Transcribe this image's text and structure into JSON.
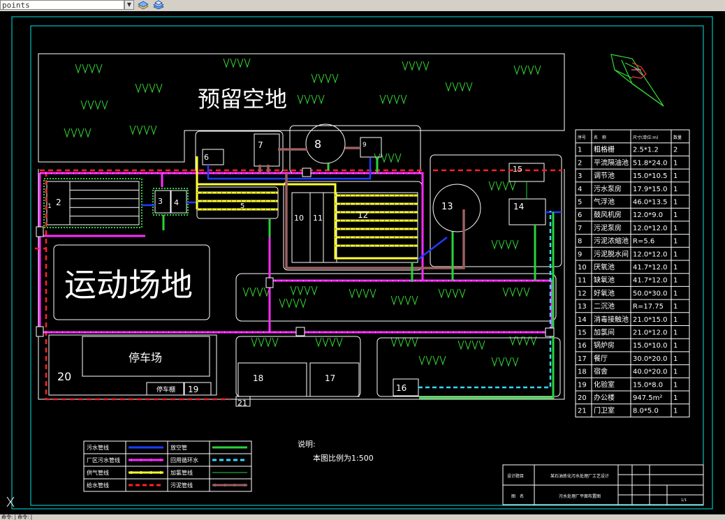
{
  "toolbar": {
    "input_value": "points",
    "drop_icon": "chevron-down-icon",
    "layer_icons": [
      "layers-icon",
      "layers-stack-icon"
    ]
  },
  "status": {
    "text": "命令: | 命令: |"
  },
  "labels": {
    "reserved_land": "预留空地",
    "sports_field": "运动场地",
    "parking": "停车场",
    "parking_shed": "停车棚",
    "building_numbers": [
      "1",
      "2",
      "3",
      "4",
      "5",
      "6",
      "7",
      "8",
      "9",
      "10",
      "11",
      "12",
      "13",
      "14",
      "15",
      "16",
      "17",
      "18",
      "19",
      "20",
      "21"
    ]
  },
  "table": {
    "headers": [
      "序号",
      "名　称",
      "尺寸(单位:m)",
      "数量"
    ],
    "rows": [
      [
        "1",
        "粗格栅",
        "2.5*1.2",
        "2"
      ],
      [
        "2",
        "平流隔油池",
        "51.8*24.0",
        "1"
      ],
      [
        "3",
        "调节池",
        "15.0*10.5",
        "1"
      ],
      [
        "4",
        "污水泵房",
        "17.9*15.0",
        "1"
      ],
      [
        "5",
        "气浮池",
        "46.0*13.5",
        "1"
      ],
      [
        "6",
        "鼓风机房",
        "12.0*9.0",
        "1"
      ],
      [
        "7",
        "污泥泵房",
        "12.0*12.0",
        "1"
      ],
      [
        "8",
        "污泥浓缩池",
        "R=5.6",
        "1"
      ],
      [
        "9",
        "污泥脱水间",
        "12.0*12.0",
        "1"
      ],
      [
        "10",
        "厌氧池",
        "41.7*12.0",
        "1"
      ],
      [
        "11",
        "缺氧池",
        "41.7*12.0",
        "1"
      ],
      [
        "12",
        "好氧池",
        "50.0*30.0",
        "1"
      ],
      [
        "13",
        "二沉池",
        "R=17.75",
        "1"
      ],
      [
        "14",
        "消毒接触池",
        "21.0*15.0",
        "1"
      ],
      [
        "15",
        "加氯间",
        "21.0*12.0",
        "1"
      ],
      [
        "16",
        "锅炉房",
        "15.0*10.0",
        "1"
      ],
      [
        "17",
        "餐厅",
        "30.0*20.0",
        "1"
      ],
      [
        "18",
        "宿舍",
        "40.0*20.0",
        "1"
      ],
      [
        "19",
        "化验室",
        "15.0*8.0",
        "1"
      ],
      [
        "20",
        "办公楼",
        "947.5m²",
        "1"
      ],
      [
        "21",
        "门卫室",
        "8.0*5.0",
        "1"
      ]
    ]
  },
  "legend": {
    "items": [
      {
        "label": "污水管线",
        "color": "#1f3cff",
        "style": "solid"
      },
      {
        "label": "放空管",
        "color": "#2bd23b",
        "style": "solid"
      },
      {
        "label": "厂区污水管线",
        "color": "#ff2bff",
        "style": "dotted"
      },
      {
        "label": "回用循环水",
        "color": "#38d8ff",
        "style": "dashed"
      },
      {
        "label": "供气管线",
        "color": "#ffff33",
        "style": "dotted"
      },
      {
        "label": "加氯管线",
        "color": "#2bd23b",
        "style": "thin"
      },
      {
        "label": "给水管线",
        "color": "#ff2222",
        "style": "dashed"
      },
      {
        "label": "污泥管线",
        "color": "#9b6060",
        "style": "dotted"
      }
    ]
  },
  "notes": {
    "title": "说明:",
    "body": "本图比例为1:500"
  },
  "title_block": {
    "cells": [
      "设计题目",
      "某石油炼化污水处理厂工艺设计",
      "图　名",
      "污水处理厂平面布置图"
    ],
    "marks": [
      "1/1"
    ]
  },
  "colors": {
    "frame": "#00e5e5",
    "outline": "#ffffff",
    "grass": "#33dd33",
    "compass": "#33dd33"
  }
}
